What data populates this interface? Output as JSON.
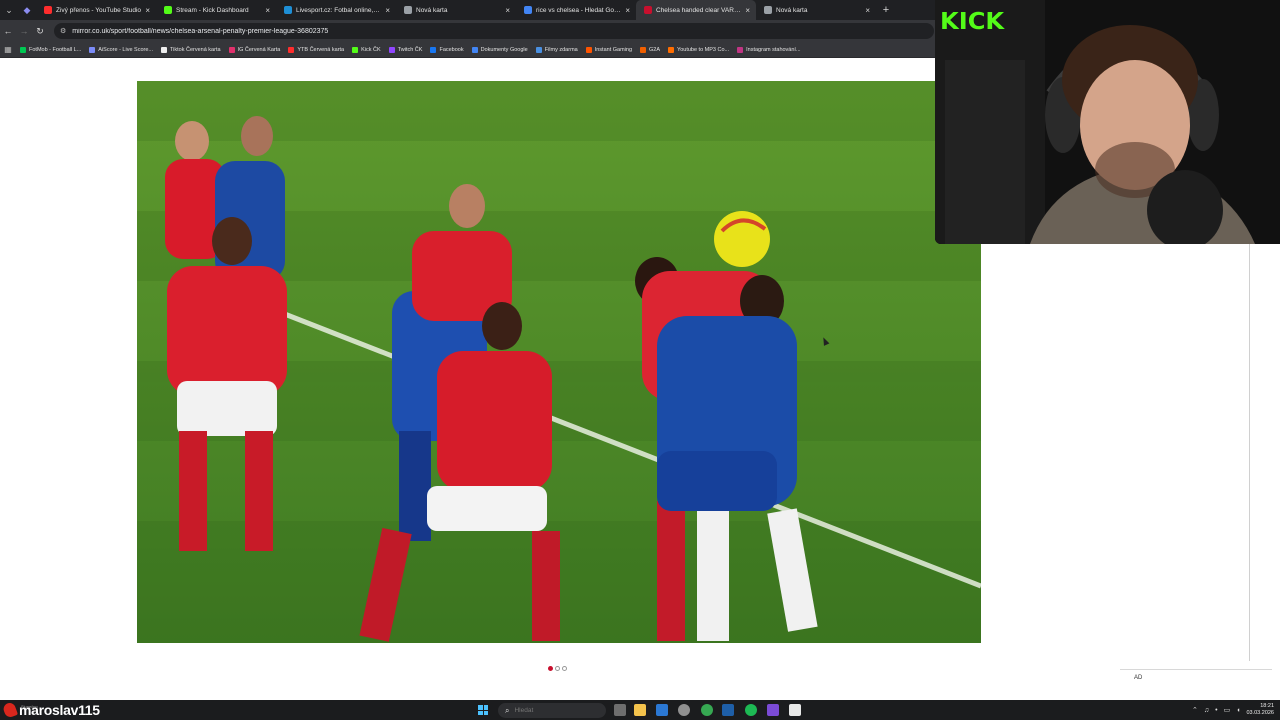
{
  "browser": {
    "tabs": [
      {
        "label": "Živý přenos - YouTube Studio",
        "favicon_color": "#ff2d2d",
        "active": false
      },
      {
        "label": "Stream - Kick Dashboard",
        "favicon_color": "#53fc18",
        "active": false
      },
      {
        "label": "Livesport.cz: Fotbal online, fotb",
        "favicon_color": "#1e8fd6",
        "active": false
      },
      {
        "label": "Nová karta",
        "favicon_color": "#9aa0a6",
        "active": false
      },
      {
        "label": "rice vs chelsea - Hledat Googlem",
        "favicon_color": "#4285f4",
        "active": false
      },
      {
        "label": "Chelsea handed clear VAR verdi",
        "favicon_color": "#c8102e",
        "active": true
      },
      {
        "label": "Nová karta",
        "favicon_color": "#9aa0a6",
        "active": false
      }
    ],
    "new_tab_symbol": "+",
    "url": "mirror.co.uk/sport/football/news/chelsea-arsenal-penalty-premier-league-36802375",
    "bookmarks": [
      {
        "label": "FotMob - Football L...",
        "color": "#00c853"
      },
      {
        "label": "AiScore - Live Score...",
        "color": "#7c8cf8"
      },
      {
        "label": "Tiktok Červená karta",
        "color": "#eeeeee"
      },
      {
        "label": "IG Červená Karta",
        "color": "#e1306c"
      },
      {
        "label": "YTB Červená karta",
        "color": "#ff2d2d"
      },
      {
        "label": "Kick ČK",
        "color": "#53fc18"
      },
      {
        "label": "Twitch ČK",
        "color": "#9146ff"
      },
      {
        "label": "Facebook",
        "color": "#1877f2"
      },
      {
        "label": "Dokumenty Google",
        "color": "#4285f4"
      },
      {
        "label": "Filmy zdarma",
        "color": "#4a90e2"
      },
      {
        "label": "Instant Gaming",
        "color": "#ff5400"
      },
      {
        "label": "G2A",
        "color": "#f05f00"
      },
      {
        "label": "Youtube to MP3 Co...",
        "color": "#ff6d00"
      },
      {
        "label": "Instagram stahování...",
        "color": "#c13584"
      }
    ]
  },
  "article": {
    "carousel_dots": [
      true,
      false,
      false
    ],
    "ad_label": "AD"
  },
  "overlay": {
    "brand": "KICK",
    "brand_color": "#53fc18",
    "streamer_name": "maroslav115",
    "weather_sub": "Slunečno"
  },
  "taskbar": {
    "search_placeholder": "Hledat",
    "time": "18:21",
    "date": "03.03.2026"
  }
}
